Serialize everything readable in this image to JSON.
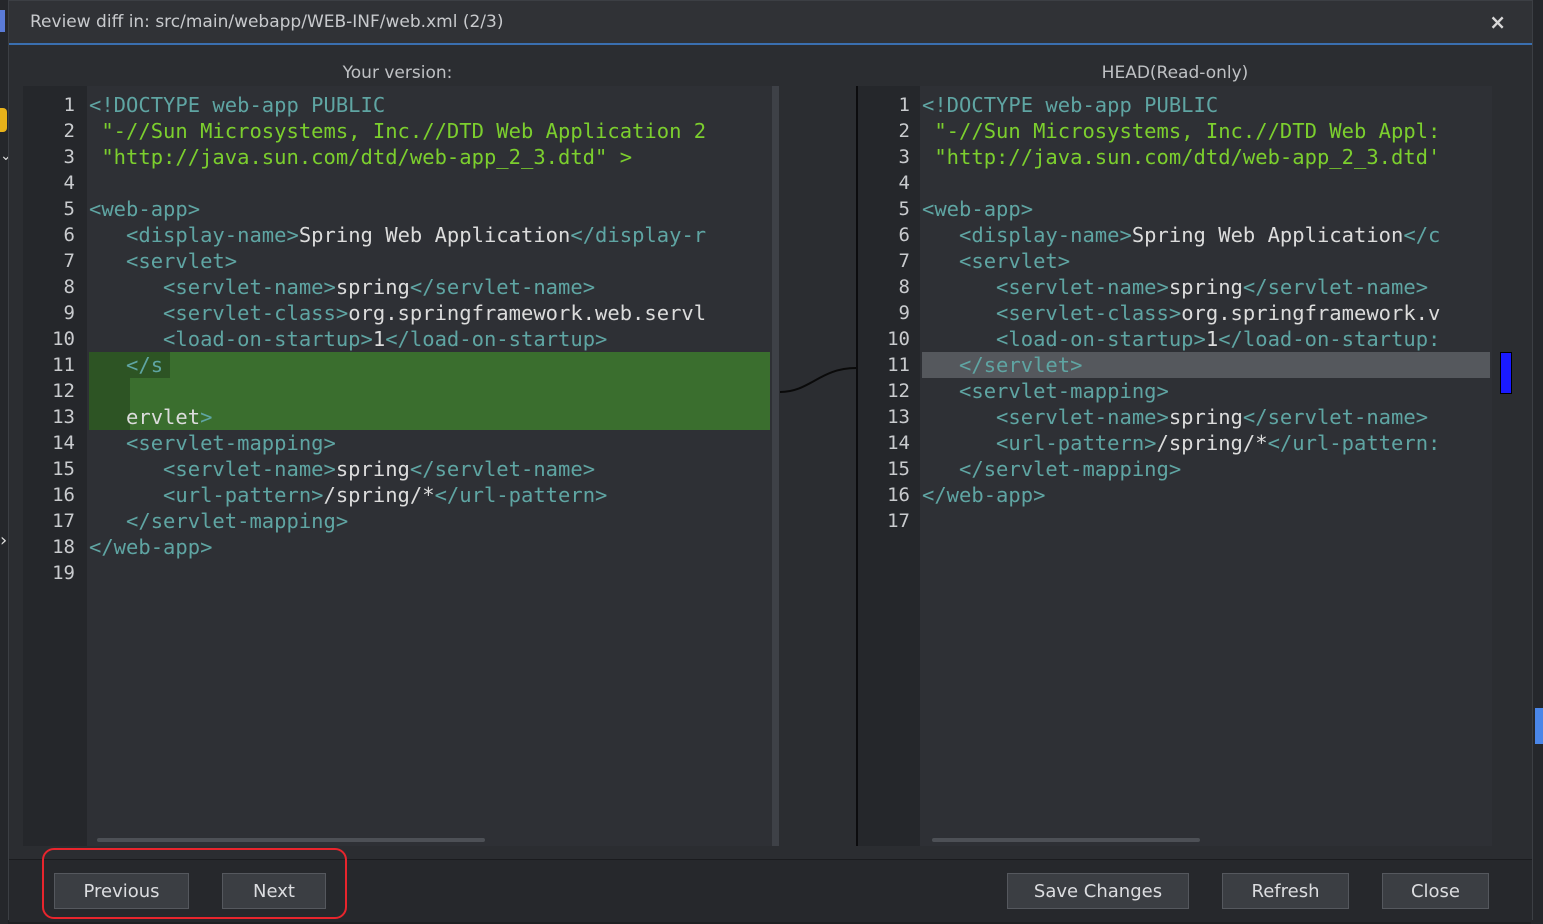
{
  "dialog": {
    "title": "Review diff in: src/main/webapp/WEB-INF/web.xml (2/3)",
    "close_glyph": "×"
  },
  "left_pane": {
    "label": "Your version:",
    "lines": [
      {
        "n": "1",
        "segs": [
          [
            "tag",
            "<!DOCTYPE web-app PUBLIC"
          ]
        ]
      },
      {
        "n": "2",
        "segs": [
          [
            "str",
            " \"-//Sun Microsystems, Inc.//DTD Web Application 2"
          ]
        ]
      },
      {
        "n": "3",
        "segs": [
          [
            "str",
            " \"http://java.sun.com/dtd/web-app_2_3.dtd\" >"
          ]
        ]
      },
      {
        "n": "4",
        "segs": []
      },
      {
        "n": "5",
        "segs": [
          [
            "tag",
            "<web-app>"
          ]
        ]
      },
      {
        "n": "6",
        "segs": [
          [
            "tag",
            "   <display-name>"
          ],
          [
            "txt",
            "Spring Web Application"
          ],
          [
            "tag",
            "</display-r"
          ]
        ]
      },
      {
        "n": "7",
        "segs": [
          [
            "tag",
            "   <servlet>"
          ]
        ]
      },
      {
        "n": "8",
        "segs": [
          [
            "tag",
            "      <servlet-name>"
          ],
          [
            "txt",
            "spring"
          ],
          [
            "tag",
            "</servlet-name>"
          ]
        ]
      },
      {
        "n": "9",
        "segs": [
          [
            "tag",
            "      <servlet-class>"
          ],
          [
            "txt",
            "org.springframework.web.servl"
          ]
        ]
      },
      {
        "n": "10",
        "segs": [
          [
            "tag",
            "      <load-on-startup>"
          ],
          [
            "txt",
            "1"
          ],
          [
            "tag",
            "</load-on-startup>"
          ]
        ]
      },
      {
        "n": "11",
        "segs": [
          [
            "tag",
            "   </s"
          ]
        ]
      },
      {
        "n": "12",
        "segs": []
      },
      {
        "n": "13",
        "segs": [
          [
            "txt",
            "   ervlet"
          ],
          [
            "tag",
            ">"
          ]
        ]
      },
      {
        "n": "14",
        "segs": [
          [
            "tag",
            "   <servlet-mapping>"
          ]
        ]
      },
      {
        "n": "15",
        "segs": [
          [
            "tag",
            "      <servlet-name>"
          ],
          [
            "txt",
            "spring"
          ],
          [
            "tag",
            "</servlet-name>"
          ]
        ]
      },
      {
        "n": "16",
        "segs": [
          [
            "tag",
            "      <url-pattern>"
          ],
          [
            "txt",
            "/spring/*"
          ],
          [
            "tag",
            "</url-pattern>"
          ]
        ]
      },
      {
        "n": "17",
        "segs": [
          [
            "tag",
            "   </servlet-mapping>"
          ]
        ]
      },
      {
        "n": "18",
        "segs": [
          [
            "tag",
            "</web-app>"
          ]
        ]
      },
      {
        "n": "19",
        "segs": []
      }
    ]
  },
  "right_pane": {
    "label": "HEAD(Read-only)",
    "lines": [
      {
        "n": "1",
        "segs": [
          [
            "tag",
            "<!DOCTYPE web-app PUBLIC"
          ]
        ]
      },
      {
        "n": "2",
        "segs": [
          [
            "str",
            " \"-//Sun Microsystems, Inc.//DTD Web Appl:"
          ]
        ]
      },
      {
        "n": "3",
        "segs": [
          [
            "str",
            " \"http://java.sun.com/dtd/web-app_2_3.dtd'"
          ]
        ]
      },
      {
        "n": "4",
        "segs": []
      },
      {
        "n": "5",
        "segs": [
          [
            "tag",
            "<web-app>"
          ]
        ]
      },
      {
        "n": "6",
        "segs": [
          [
            "tag",
            "   <display-name>"
          ],
          [
            "txt",
            "Spring Web Application"
          ],
          [
            "tag",
            "</c"
          ]
        ]
      },
      {
        "n": "7",
        "segs": [
          [
            "tag",
            "   <servlet>"
          ]
        ]
      },
      {
        "n": "8",
        "segs": [
          [
            "tag",
            "      <servlet-name>"
          ],
          [
            "txt",
            "spring"
          ],
          [
            "tag",
            "</servlet-name>"
          ]
        ]
      },
      {
        "n": "9",
        "segs": [
          [
            "tag",
            "      <servlet-class>"
          ],
          [
            "txt",
            "org.springframework.v"
          ]
        ]
      },
      {
        "n": "10",
        "segs": [
          [
            "tag",
            "      <load-on-startup>"
          ],
          [
            "txt",
            "1"
          ],
          [
            "tag",
            "</load-on-startup:"
          ]
        ]
      },
      {
        "n": "11",
        "segs": [
          [
            "tag",
            "   </servlet>"
          ]
        ]
      },
      {
        "n": "12",
        "segs": [
          [
            "tag",
            "   <servlet-mapping>"
          ]
        ]
      },
      {
        "n": "13",
        "segs": [
          [
            "tag",
            "      <servlet-name>"
          ],
          [
            "txt",
            "spring"
          ],
          [
            "tag",
            "</servlet-name>"
          ]
        ]
      },
      {
        "n": "14",
        "segs": [
          [
            "tag",
            "      <url-pattern>"
          ],
          [
            "txt",
            "/spring/*"
          ],
          [
            "tag",
            "</url-pattern:"
          ]
        ]
      },
      {
        "n": "15",
        "segs": [
          [
            "tag",
            "   </servlet-mapping>"
          ]
        ]
      },
      {
        "n": "16",
        "segs": [
          [
            "tag",
            "</web-app>"
          ]
        ]
      },
      {
        "n": "17",
        "segs": []
      }
    ]
  },
  "buttons": {
    "previous": "Previous",
    "next": "Next",
    "save_changes": "Save Changes",
    "refresh": "Refresh",
    "close": "Close"
  },
  "colors": {
    "added_bg": "#3a6e2e",
    "changed_bg": "#55585d",
    "tag": "#5fa5a3",
    "string": "#7ccf2e",
    "text": "#dcdcdc",
    "highlight_box": "#e8252d",
    "diff_marker": "#1a1aff"
  }
}
